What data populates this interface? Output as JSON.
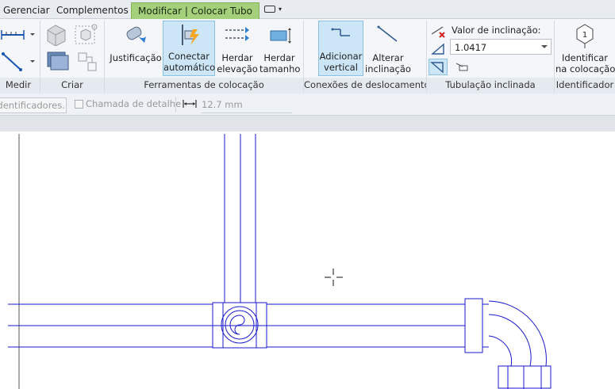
{
  "tabs": [
    {
      "label": "Gerenciar",
      "active": false
    },
    {
      "label": "Complementos",
      "active": false
    },
    {
      "label": "Modificar | Colocar Tubo",
      "active": true
    }
  ],
  "ribbon": {
    "medir": {
      "label": "Medir"
    },
    "criar": {
      "label": "Criar"
    },
    "justificacao": {
      "label": "Justificação"
    },
    "conectar": {
      "line1": "Conectar",
      "line2": "automático"
    },
    "herdar_elevacao": {
      "line1": "Herdar",
      "line2": "elevação"
    },
    "herdar_tamanho": {
      "line1": "Herdar",
      "line2": "tamanho"
    },
    "adicionar_vertical": {
      "line1": "Adicionar",
      "line2": "vertical"
    },
    "alterar_inclinacao": {
      "line1": "Alterar",
      "line2": "inclinação"
    },
    "slope_label": "Valor de inclinação:",
    "slope_value": "1.0417",
    "identificar": {
      "line1": "Identificar",
      "line2": "na colocação",
      "glyph": "1"
    },
    "panels": {
      "ferramentas": "Ferramentas de colocação",
      "conexoes": "Conexões de deslocamento",
      "tubulacao": "Tubulação inclinada",
      "identificador": "Identificador"
    }
  },
  "optionsbar": {
    "identificadores": "Identificadores...",
    "chamada": "Chamada de detalhe",
    "length": "12.7 mm"
  },
  "colors": {
    "accent_tab": "#a4d07b",
    "selected": "#cde6f7",
    "pipe": "#1a1acc"
  }
}
